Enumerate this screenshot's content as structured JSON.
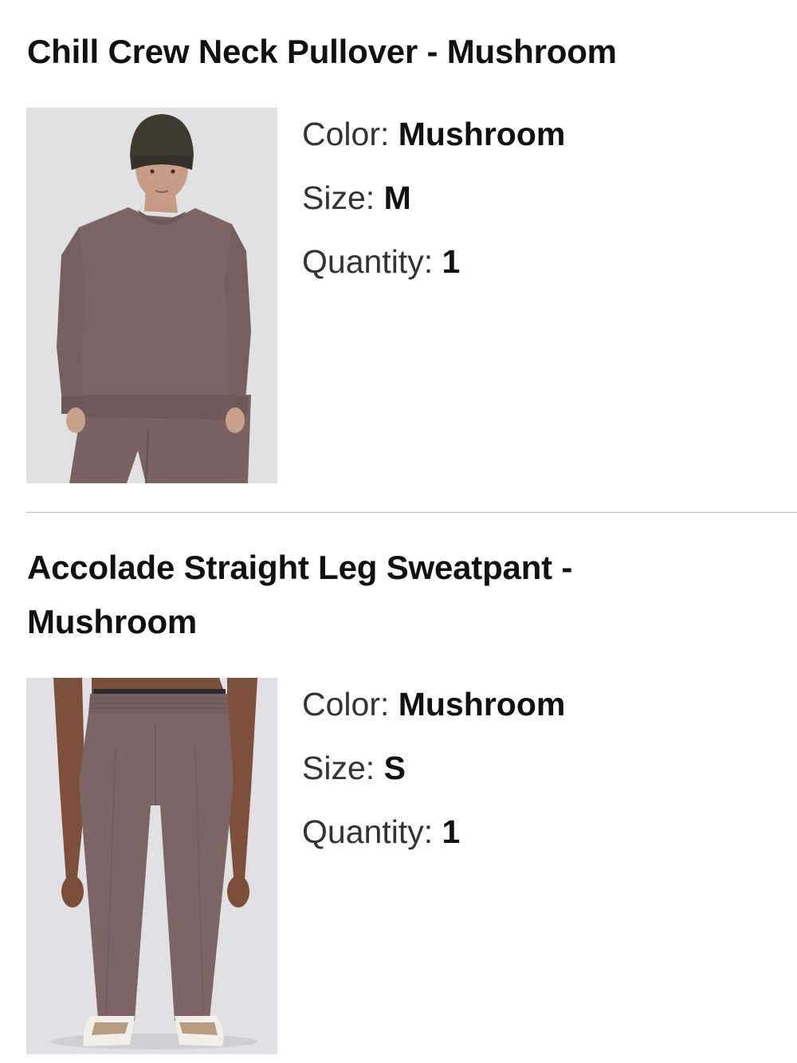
{
  "items": [
    {
      "title": "Chill Crew Neck Pullover - Mushroom",
      "image_icon": "product-photo-pullover",
      "color_label": "Color:",
      "color_value": "Mushroom",
      "size_label": "Size:",
      "size_value": "M",
      "quantity_label": "Quantity:",
      "quantity_value": "1"
    },
    {
      "title": "Accolade Straight Leg Sweatpant - Mushroom",
      "image_icon": "product-photo-sweatpant",
      "color_label": "Color:",
      "color_value": "Mushroom",
      "size_label": "Size:",
      "size_value": "S",
      "quantity_label": "Quantity:",
      "quantity_value": "1"
    }
  ],
  "colors": {
    "mushroom": "#7d6563",
    "photo_background": "#e6e5e7",
    "divider": "#bdbdbd"
  }
}
